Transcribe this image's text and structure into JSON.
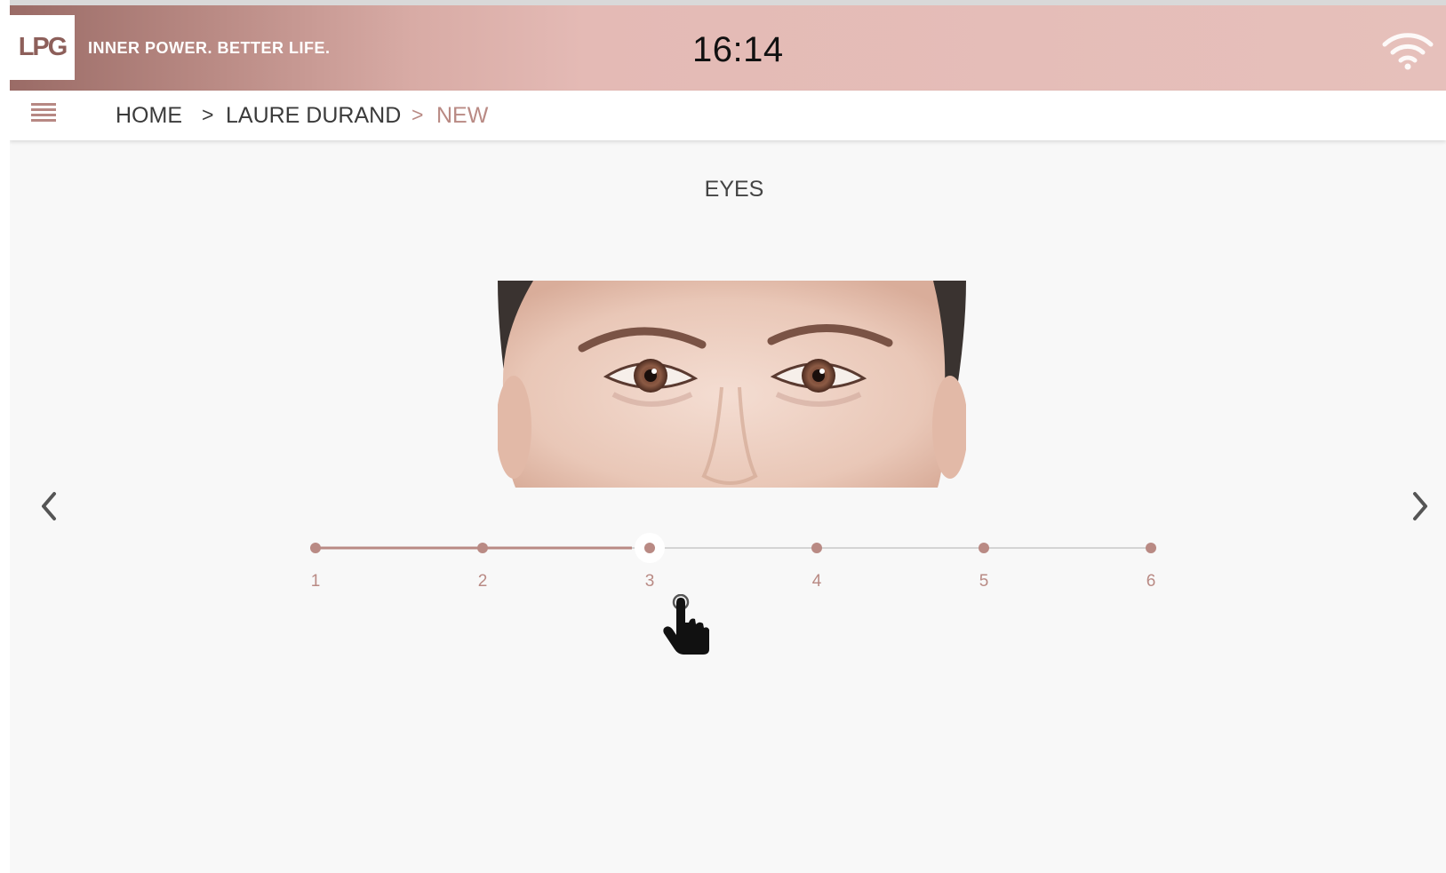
{
  "header": {
    "logo": "LPG",
    "tagline": "INNER POWER. BETTER LIFE.",
    "clock": "16:14",
    "wifi_icon": "wifi-icon"
  },
  "breadcrumb": {
    "menu_icon": "hamburger-menu-icon",
    "items": [
      "HOME",
      "LAURE DURAND",
      "NEW"
    ],
    "separator": ">"
  },
  "main": {
    "title": "EYES",
    "prev_icon": "chevron-left-icon",
    "next_icon": "chevron-right-icon",
    "slider": {
      "steps": [
        "1",
        "2",
        "3",
        "4",
        "5",
        "6"
      ],
      "selected": 3,
      "accent": "#b98a84"
    }
  },
  "colors": {
    "accent": "#b98a84",
    "brand": "#8d5f5a"
  }
}
